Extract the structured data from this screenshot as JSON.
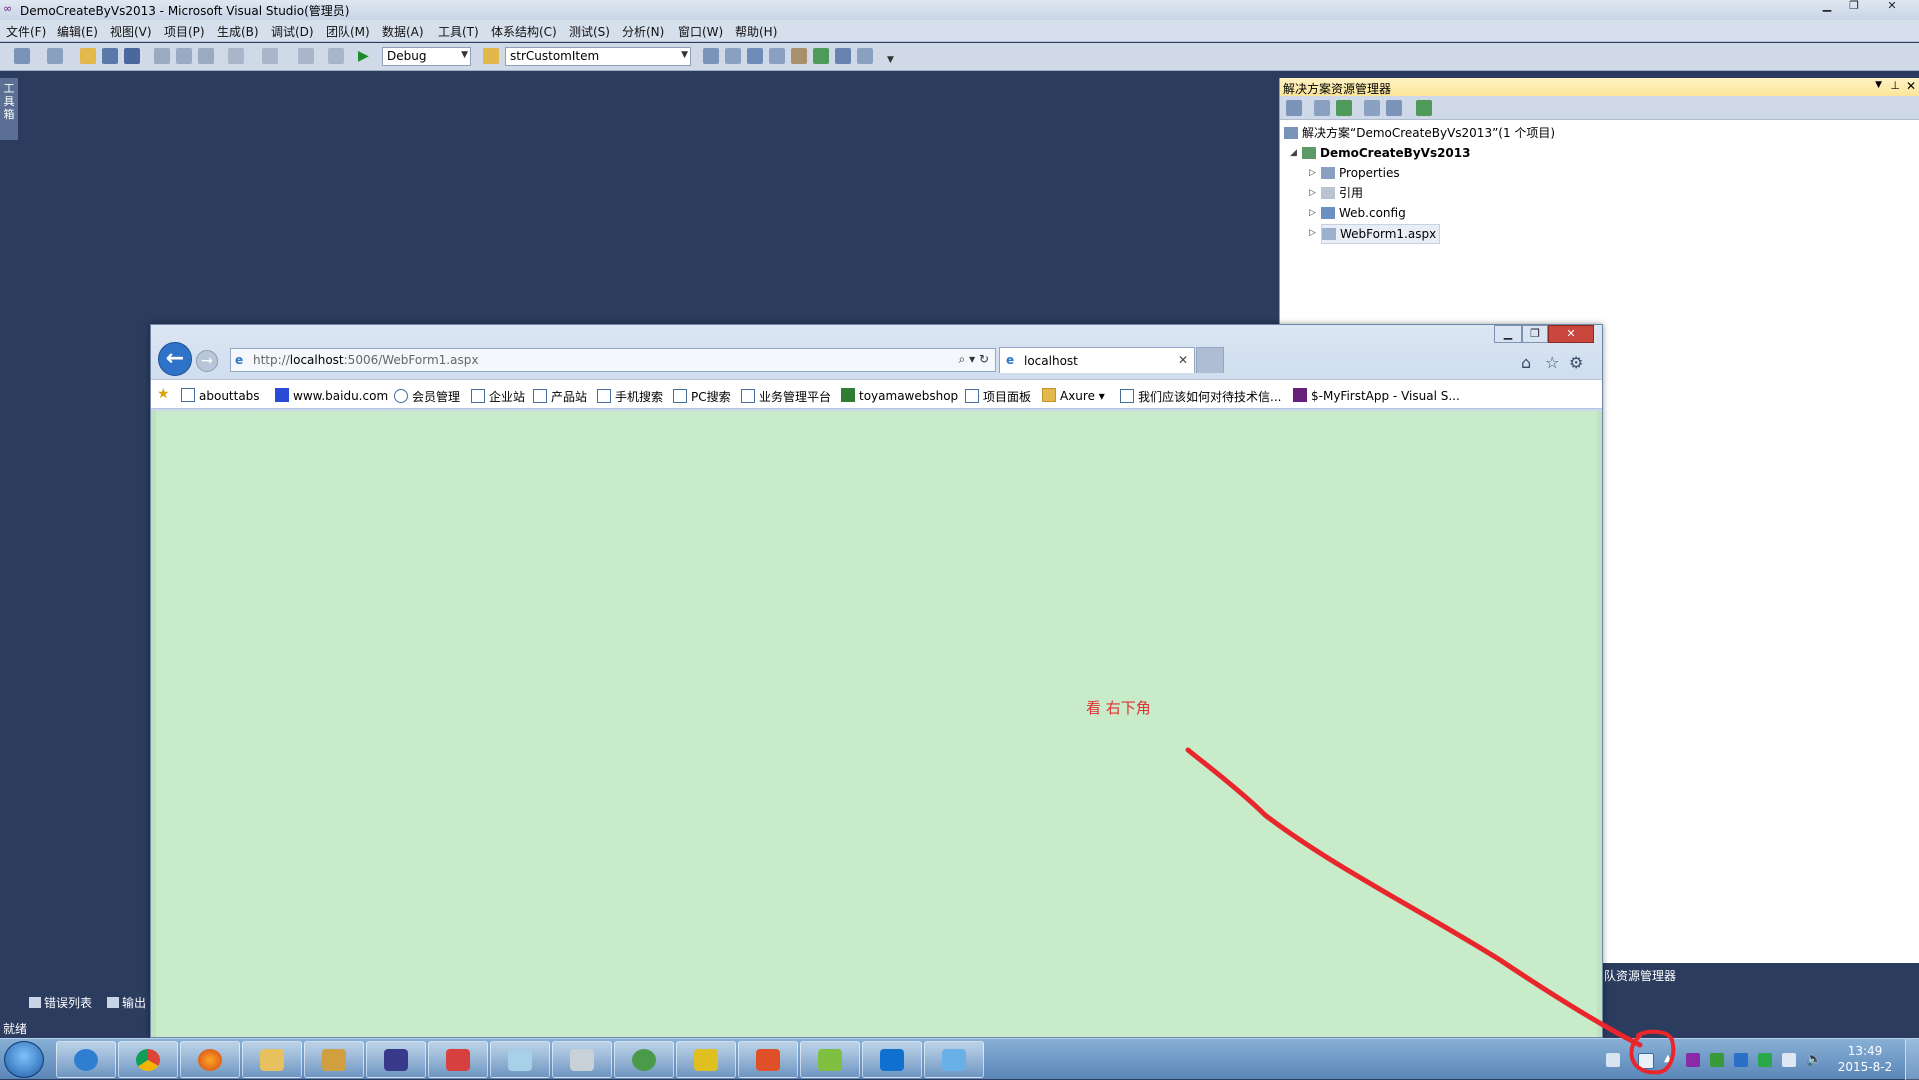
{
  "vs": {
    "title": "DemoCreateByVs2013 - Microsoft Visual Studio(管理员)",
    "menu": [
      "文件(F)",
      "编辑(E)",
      "视图(V)",
      "项目(P)",
      "生成(B)",
      "调试(D)",
      "团队(M)",
      "数据(A)",
      "工具(T)",
      "体系结构(C)",
      "测试(S)",
      "分析(N)",
      "窗口(W)",
      "帮助(H)"
    ],
    "config_combo": "Debug",
    "find_combo": "strCustomItem",
    "toolbox_label": "工具箱",
    "bottom_tabs": [
      "错误列表",
      "输出"
    ],
    "status": "就绪",
    "team_explorer_tab": "队资源管理器"
  },
  "solution_explorer": {
    "title": "解决方案资源管理器",
    "solution_label": "解决方案“DemoCreateByVs2013”(1 个项目)",
    "project": "DemoCreateByVs2013",
    "items": [
      "Properties",
      "引用",
      "Web.config",
      "WebForm1.aspx"
    ]
  },
  "browser": {
    "url_prefix": "http://",
    "url_host": "localhost",
    "url_rest": ":5006/WebForm1.aspx",
    "tab_title": "localhost",
    "favorites": [
      "abouttabs",
      "www.baidu.com",
      "会员管理",
      "企业站",
      "产品站",
      "手机搜索",
      "PC搜索",
      "业务管理平台",
      "toyamawebshop",
      "项目面板",
      "Axure ▾",
      "我们应该如何对待技术信...",
      "$-MyFirstApp - Visual S..."
    ],
    "page_note": "看 右下角"
  },
  "taskbar": {
    "time": "13:49",
    "date": "2015-8-2"
  },
  "colors": {
    "vs_bg": "#2b3c5e",
    "page_bg": "#c8ecc9",
    "annotation_red": "#e03131"
  }
}
